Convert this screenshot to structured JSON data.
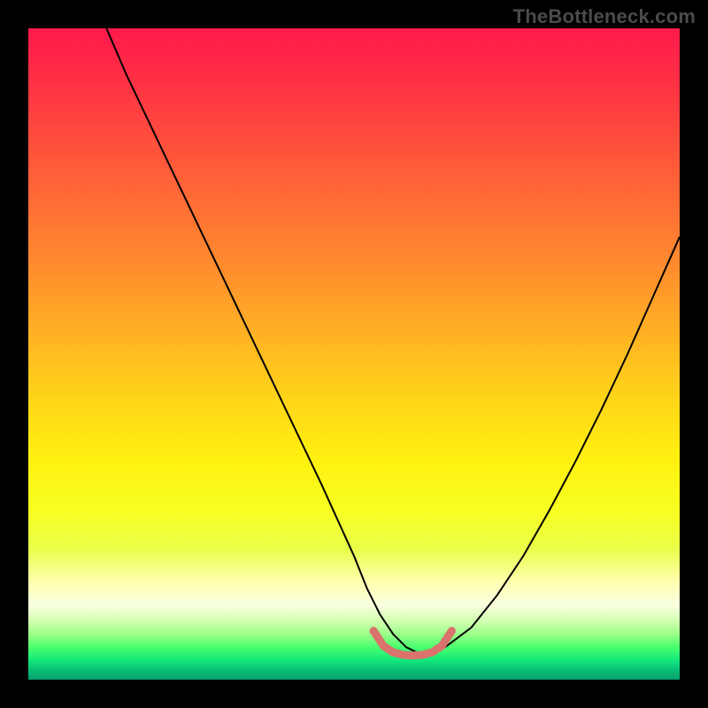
{
  "watermark": "TheBottleneck.com",
  "chart_data": {
    "type": "line",
    "title": "",
    "xlabel": "",
    "ylabel": "",
    "xlim": [
      0,
      100
    ],
    "ylim": [
      0,
      100
    ],
    "series": [
      {
        "name": "bottleneck-curve",
        "color": "#000000",
        "width": 2,
        "x": [
          12,
          15,
          20,
          25,
          30,
          35,
          40,
          45,
          50,
          52,
          54,
          56,
          58,
          60,
          62,
          64,
          68,
          72,
          76,
          80,
          84,
          88,
          92,
          96,
          100
        ],
        "y": [
          100,
          93,
          82.5,
          72,
          61.5,
          51,
          40.5,
          30,
          19,
          14,
          10,
          7,
          5,
          4,
          4,
          5,
          8,
          13,
          19,
          26,
          33.5,
          41.5,
          50,
          59,
          68
        ]
      },
      {
        "name": "optimal-range-marker",
        "color": "#d9736b",
        "width": 9,
        "linecap": "round",
        "x": [
          53,
          54.5,
          56,
          57.5,
          59,
          60.5,
          62,
          63.5,
          65
        ],
        "y": [
          7.5,
          5.2,
          4.2,
          3.8,
          3.7,
          3.8,
          4.2,
          5.2,
          7.5
        ]
      }
    ],
    "background_gradient": [
      {
        "color": "#ff1a4b",
        "stop": 0
      },
      {
        "color": "#ff2a46",
        "stop": 6
      },
      {
        "color": "#ff4a3e",
        "stop": 16
      },
      {
        "color": "#ff6a36",
        "stop": 26
      },
      {
        "color": "#ff8a2e",
        "stop": 36
      },
      {
        "color": "#ffae24",
        "stop": 46
      },
      {
        "color": "#ffd21a",
        "stop": 56
      },
      {
        "color": "#fff010",
        "stop": 66
      },
      {
        "color": "#f7ff20",
        "stop": 74
      },
      {
        "color": "#e8ff4a",
        "stop": 80
      },
      {
        "color": "#ffffb0",
        "stop": 85
      },
      {
        "color": "#f8ffe0",
        "stop": 88.5
      },
      {
        "color": "#d2ffb0",
        "stop": 91
      },
      {
        "color": "#9cff8a",
        "stop": 93
      },
      {
        "color": "#4bff6e",
        "stop": 95
      },
      {
        "color": "#12e87a",
        "stop": 97
      },
      {
        "color": "#0abf78",
        "stop": 98.5
      },
      {
        "color": "#06a06c",
        "stop": 100
      }
    ]
  }
}
